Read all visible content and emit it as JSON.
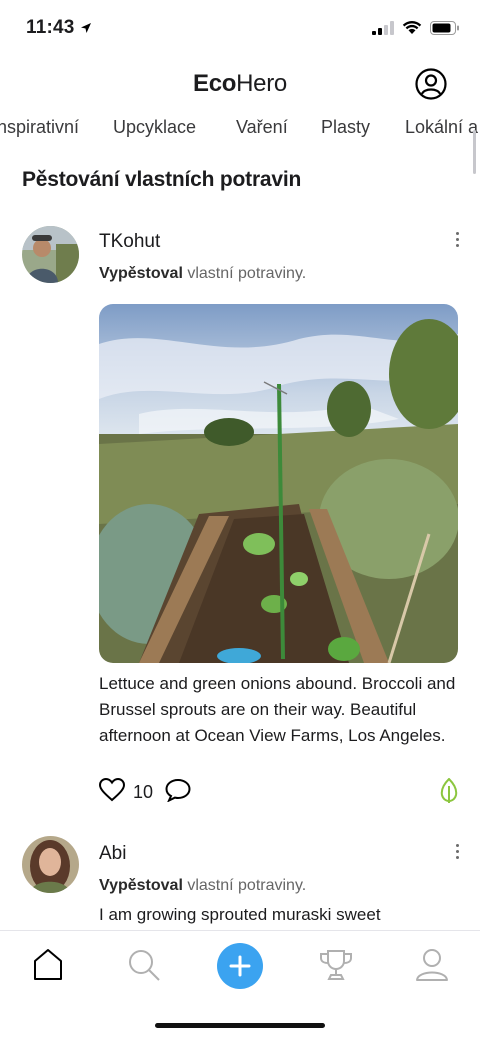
{
  "status": {
    "time": "11:43"
  },
  "app": {
    "title_bold": "Eco",
    "title_light": "Hero"
  },
  "tabs": [
    "Inspirativní",
    "Upcyklace",
    "Vaření",
    "Plasty",
    "Lokální a"
  ],
  "section": {
    "title": "Pěstování vlastních potravin"
  },
  "posts": [
    {
      "author": "TKohut",
      "verb": "Vypěstoval",
      "rest": " vlastní potraviny.",
      "caption": "Lettuce and green onions abound. Broccoli and Brussel sprouts are on their way. Beautiful afternoon at Ocean View Farms, Los Angeles.",
      "likes": "10"
    },
    {
      "author": "Abi",
      "verb": "Vypěstoval",
      "rest": " vlastní potraviny.",
      "caption": "I am growing sprouted muraski sweet"
    }
  ],
  "icons": {
    "status_location": "location-arrow-icon",
    "signal": "signal-icon",
    "wifi": "wifi-icon",
    "battery": "battery-icon",
    "profile": "profile-circle-icon",
    "more": "more-vertical-icon",
    "like": "heart-icon",
    "comment": "comment-icon",
    "eco": "leaf-icon",
    "nav": [
      "home-icon",
      "search-icon",
      "plus-icon",
      "trophy-icon",
      "user-icon"
    ]
  },
  "colors": {
    "accent": "#3ba3f0",
    "eco_green": "#8cc63f",
    "text": "#1c1c1e",
    "muted": "#666666"
  }
}
